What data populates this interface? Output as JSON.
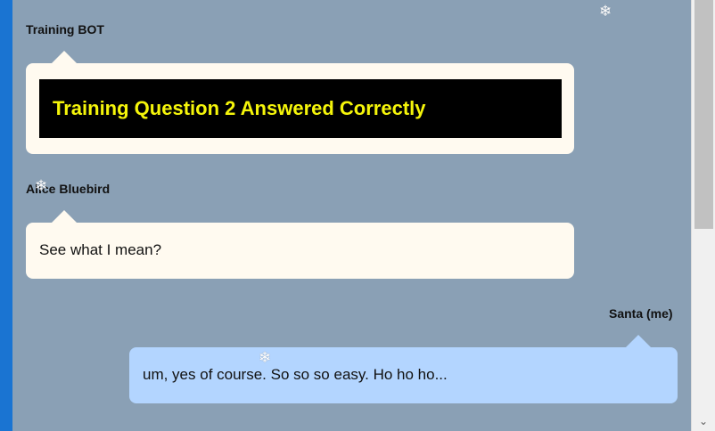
{
  "messages": [
    {
      "sender": "Training BOT",
      "direction": "incoming",
      "banner_text": "Training Question 2 Answered Correctly"
    },
    {
      "sender": "Alice Bluebird",
      "direction": "incoming",
      "text": "See what I mean?"
    },
    {
      "sender": "Santa (me)",
      "direction": "outgoing",
      "text": "um, yes of course. So so so easy. Ho ho ho..."
    }
  ],
  "decorations": {
    "snowflake_glyph": "❄"
  },
  "scrollbar": {
    "down_arrow": "⌄"
  },
  "colors": {
    "background": "#8aa0b5",
    "accent_bar": "#1a74d2",
    "incoming_bubble": "#fffaf0",
    "outgoing_bubble": "#b3d5ff",
    "banner_bg": "#000000",
    "banner_text": "#f5f50a"
  }
}
